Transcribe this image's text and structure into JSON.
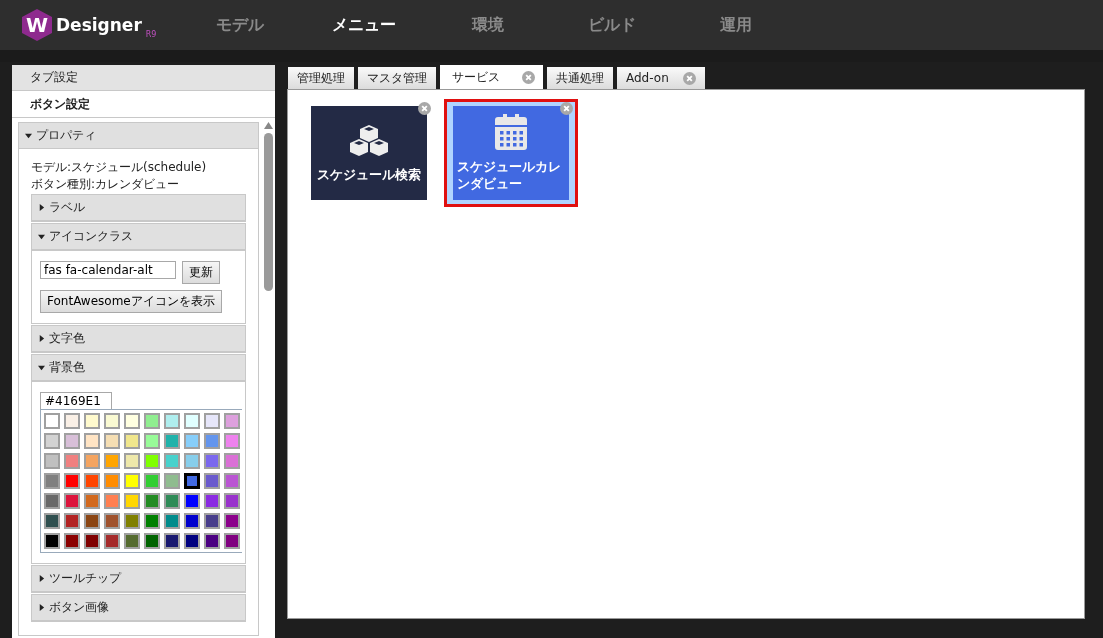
{
  "header": {
    "logo_mark": "W",
    "logo_text": "Designer",
    "logo_version": "R9",
    "nav": [
      {
        "label": "モデル",
        "selected": false
      },
      {
        "label": "メニュー",
        "selected": true
      },
      {
        "label": "環境",
        "selected": false
      },
      {
        "label": "ビルド",
        "selected": false
      },
      {
        "label": "運用",
        "selected": false
      }
    ]
  },
  "sidebar": {
    "sections": [
      {
        "label": "タブ設定",
        "selected": false
      },
      {
        "label": "ボタン設定",
        "selected": true
      }
    ],
    "panel": {
      "label": "プロパティ",
      "expanded": true,
      "model_line": "モデル:スケジュール(schedule)",
      "type_line": "ボタン種別:カレンダビュー",
      "groups": [
        {
          "label": "ラベル",
          "expanded": false
        },
        {
          "kind": "icon_class",
          "label": "アイコンクラス",
          "expanded": true,
          "value": "fas fa-calendar-alt",
          "update_button": "更新",
          "show_icons_button": "FontAwesomeアイコンを表示"
        },
        {
          "label": "文字色",
          "expanded": false
        },
        {
          "kind": "color",
          "label": "背景色",
          "expanded": true,
          "value": "#4169E1",
          "palette": [
            [
              {
                "color": "#ffffff",
                "selected": false
              },
              {
                "color": "#faf0e6",
                "selected": false
              },
              {
                "color": "#fffacd",
                "selected": false
              },
              {
                "color": "#fafad2",
                "selected": false
              },
              {
                "color": "#ffffe0",
                "selected": false
              },
              {
                "color": "#90ee90",
                "selected": false
              },
              {
                "color": "#afeeee",
                "selected": false
              },
              {
                "color": "#e0ffff",
                "selected": false
              },
              {
                "color": "#e6e6fa",
                "selected": false
              },
              {
                "color": "#dda0dd",
                "selected": false
              }
            ],
            [
              {
                "color": "#d3d3d3",
                "selected": false
              },
              {
                "color": "#d8bfd8",
                "selected": false
              },
              {
                "color": "#ffe4c4",
                "selected": false
              },
              {
                "color": "#f5deb3",
                "selected": false
              },
              {
                "color": "#f0e68c",
                "selected": false
              },
              {
                "color": "#98fb98",
                "selected": false
              },
              {
                "color": "#20b2aa",
                "selected": false
              },
              {
                "color": "#87cefa",
                "selected": false
              },
              {
                "color": "#6495ed",
                "selected": false
              },
              {
                "color": "#ee82ee",
                "selected": false
              }
            ],
            [
              {
                "color": "#c0c0c0",
                "selected": false
              },
              {
                "color": "#f08080",
                "selected": false
              },
              {
                "color": "#f4a460",
                "selected": false
              },
              {
                "color": "#ffa500",
                "selected": false
              },
              {
                "color": "#eee8aa",
                "selected": false
              },
              {
                "color": "#7fff00",
                "selected": false
              },
              {
                "color": "#48d1cc",
                "selected": false
              },
              {
                "color": "#87ceeb",
                "selected": false
              },
              {
                "color": "#7b68ee",
                "selected": false
              },
              {
                "color": "#da70d6",
                "selected": false
              }
            ],
            [
              {
                "color": "#808080",
                "selected": false
              },
              {
                "color": "#ff0000",
                "selected": false
              },
              {
                "color": "#ff4500",
                "selected": false
              },
              {
                "color": "#ff8c00",
                "selected": false
              },
              {
                "color": "#ffff00",
                "selected": false
              },
              {
                "color": "#32cd32",
                "selected": false
              },
              {
                "color": "#8fbc8f",
                "selected": false
              },
              {
                "color": "#4169e1",
                "selected": true
              },
              {
                "color": "#6a5acd",
                "selected": false
              },
              {
                "color": "#ba55d3",
                "selected": false
              }
            ],
            [
              {
                "color": "#696969",
                "selected": false
              },
              {
                "color": "#dc143c",
                "selected": false
              },
              {
                "color": "#d2691e",
                "selected": false
              },
              {
                "color": "#ff7f50",
                "selected": false
              },
              {
                "color": "#ffd700",
                "selected": false
              },
              {
                "color": "#228b22",
                "selected": false
              },
              {
                "color": "#2e8b57",
                "selected": false
              },
              {
                "color": "#0000ff",
                "selected": false
              },
              {
                "color": "#8a2be2",
                "selected": false
              },
              {
                "color": "#9932cc",
                "selected": false
              }
            ],
            [
              {
                "color": "#2f4f4f",
                "selected": false
              },
              {
                "color": "#b22222",
                "selected": false
              },
              {
                "color": "#8b4513",
                "selected": false
              },
              {
                "color": "#a0522d",
                "selected": false
              },
              {
                "color": "#808000",
                "selected": false
              },
              {
                "color": "#008000",
                "selected": false
              },
              {
                "color": "#008b8b",
                "selected": false
              },
              {
                "color": "#0000cd",
                "selected": false
              },
              {
                "color": "#483d8b",
                "selected": false
              },
              {
                "color": "#8b008b",
                "selected": false
              }
            ],
            [
              {
                "color": "#000000",
                "selected": false
              },
              {
                "color": "#8b0000",
                "selected": false
              },
              {
                "color": "#800000",
                "selected": false
              },
              {
                "color": "#a52a2a",
                "selected": false
              },
              {
                "color": "#556b2f",
                "selected": false
              },
              {
                "color": "#006400",
                "selected": false
              },
              {
                "color": "#191970",
                "selected": false
              },
              {
                "color": "#000080",
                "selected": false
              },
              {
                "color": "#4b0082",
                "selected": false
              },
              {
                "color": "#800080",
                "selected": false
              }
            ]
          ]
        },
        {
          "label": "ツールチップ",
          "expanded": false
        },
        {
          "label": "ボタン画像",
          "expanded": false
        }
      ]
    }
  },
  "tabs": [
    {
      "label": "管理処理",
      "selected": false,
      "closable": false
    },
    {
      "label": "マスタ管理",
      "selected": false,
      "closable": false
    },
    {
      "label": "サービス",
      "selected": true,
      "closable": true
    },
    {
      "label": "共通処理",
      "selected": false,
      "closable": false
    },
    {
      "label": "Add-on",
      "selected": false,
      "closable": true
    }
  ],
  "tiles": [
    {
      "label": "スケジュール検索",
      "kind": "cubes",
      "color": "#232a45",
      "selected": false
    },
    {
      "label": "スケジュールカレンダビュー",
      "kind": "calendar",
      "color": "#4169e1",
      "selected": true
    }
  ]
}
